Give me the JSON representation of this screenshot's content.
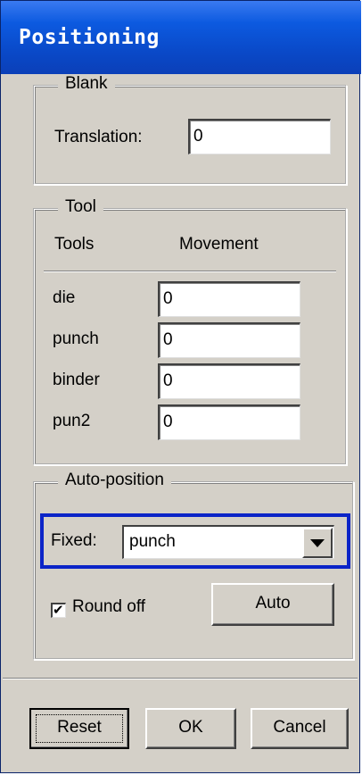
{
  "window": {
    "title": "Positioning"
  },
  "blank": {
    "legend": "Blank",
    "translation_label": "Translation:",
    "translation_value": "0"
  },
  "tool": {
    "legend": "Tool",
    "col_tools": "Tools",
    "col_movement": "Movement",
    "rows": [
      {
        "name": "die",
        "value": "0"
      },
      {
        "name": "punch",
        "value": "0"
      },
      {
        "name": "binder",
        "value": "0"
      },
      {
        "name": "pun2",
        "value": "0"
      }
    ]
  },
  "auto_position": {
    "legend": "Auto-position",
    "fixed_label": "Fixed:",
    "fixed_value": "punch",
    "round_off_label": "Round off",
    "round_off_checked": true,
    "auto_button": "Auto"
  },
  "footer": {
    "reset": "Reset",
    "ok": "OK",
    "cancel": "Cancel"
  },
  "colors": {
    "titlebar": "#0a49c8",
    "highlight": "#0b24c8",
    "face": "#d4d0c8"
  }
}
